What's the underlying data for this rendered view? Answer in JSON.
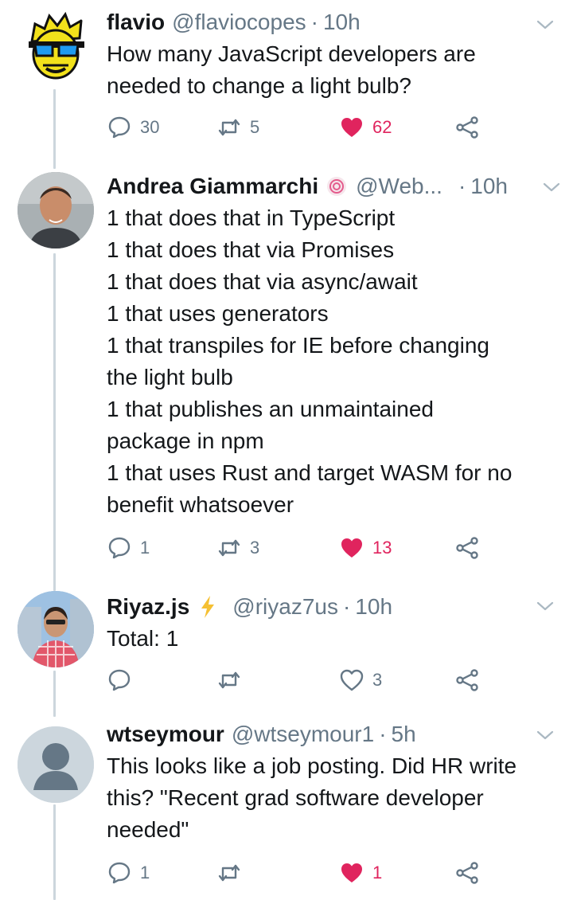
{
  "tweets": [
    {
      "name": "flavio",
      "handle": "@flaviocopes",
      "time": "10h",
      "text": "How many JavaScript developers are\nneeded to change a light bulb?",
      "replies": "30",
      "retweets": "5",
      "likes": "62",
      "liked": true
    },
    {
      "name": "Andrea Giammarchi",
      "handle": "@Web...",
      "time": "10h",
      "text": "1 that does that in TypeScript\n1 that does that via Promises\n1 that does that via async/await\n1 that uses generators\n1 that transpiles for IE before changing\nthe light bulb\n1 that publishes an unmaintained\npackage in npm\n1 that uses Rust and target WASM for no\nbenefit whatsoever",
      "replies": "1",
      "retweets": "3",
      "likes": "13",
      "liked": true
    },
    {
      "name": "Riyaz.js",
      "handle": "@riyaz7us",
      "time": "10h",
      "text": "Total: 1",
      "replies": "",
      "retweets": "",
      "likes": "3",
      "liked": false
    },
    {
      "name": "wtseymour",
      "handle": "@wtseymour1",
      "time": "5h",
      "text": "This looks like a job posting. Did HR write\nthis? \"Recent grad software developer\nneeded\"",
      "replies": "1",
      "retweets": "",
      "likes": "1",
      "liked": true
    }
  ],
  "colors": {
    "like_active": "#e0245e",
    "muted": "#657786",
    "thread_line": "#ccd6dd"
  },
  "icons": [
    "reply-icon",
    "retweet-icon",
    "like-icon",
    "share-icon",
    "chevron-down-icon",
    "lollipop-badge-icon",
    "lightning-badge-icon"
  ]
}
